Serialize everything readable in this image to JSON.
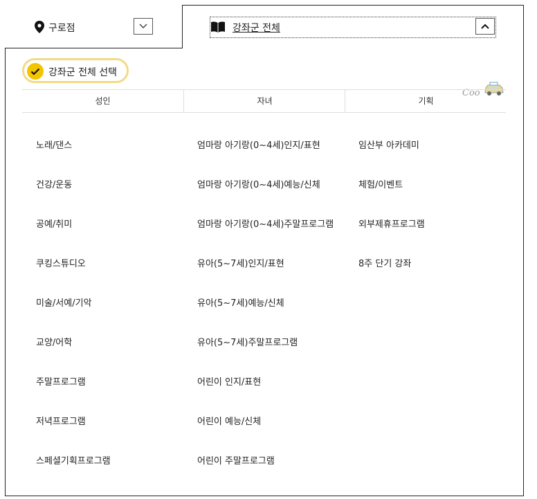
{
  "branch": {
    "label": "구로점",
    "icon": "map-pin-icon"
  },
  "course_filter": {
    "label": "강좌군 전체",
    "icon": "book-icon",
    "state": "expanded"
  },
  "select_all": {
    "label": "강좌군 전체 선택",
    "checked": true,
    "accent": "#f2c500"
  },
  "logo": {
    "text": "Coo"
  },
  "columns": [
    {
      "header": "성인",
      "items": [
        "노래/댄스",
        "건강/운동",
        "공예/취미",
        "쿠킹스튜디오",
        "미술/서예/기악",
        "교양/어학",
        "주말프로그램",
        "저녁프로그램",
        "스페셜기획프로그램"
      ]
    },
    {
      "header": "자녀",
      "items": [
        "엄마랑 아기랑(0~4세)인지/표현",
        "엄마랑 아기랑(0~4세)예능/신체",
        "엄마랑 아기랑(0~4세)주말프로그램",
        "유아(5~7세)인지/표현",
        "유아(5~7세)예능/신체",
        "유아(5~7세)주말프로그램",
        "어린이 인지/표현",
        "어린이 예능/신체",
        "어린이 주말프로그램"
      ]
    },
    {
      "header": "기획",
      "items": [
        "임산부 아카데미",
        "체험/이벤트",
        "외부제휴프로그램",
        "8주 단기 강좌"
      ]
    }
  ]
}
